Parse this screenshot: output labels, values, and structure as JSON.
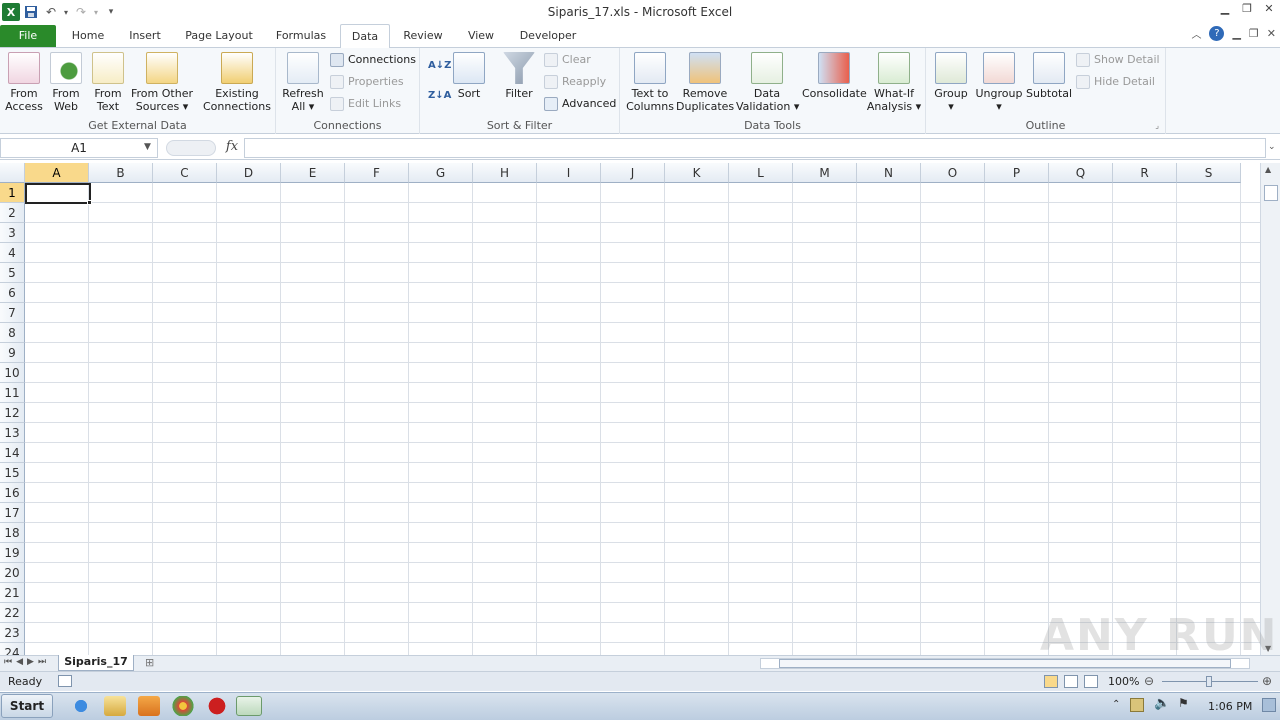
{
  "window": {
    "title": "Siparis_17.xls - Microsoft Excel"
  },
  "tabs": [
    {
      "label": "File"
    },
    {
      "label": "Home"
    },
    {
      "label": "Insert"
    },
    {
      "label": "Page Layout"
    },
    {
      "label": "Formulas"
    },
    {
      "label": "Data"
    },
    {
      "label": "Review"
    },
    {
      "label": "View"
    },
    {
      "label": "Developer"
    }
  ],
  "ribbon": {
    "get_external": {
      "label": "Get External Data",
      "from_access": "From\nAccess",
      "from_web": "From\nWeb",
      "from_text": "From\nText",
      "from_other": "From Other\nSources ▾",
      "existing": "Existing\nConnections"
    },
    "connections": {
      "label": "Connections",
      "refresh": "Refresh\nAll ▾",
      "connections": "Connections",
      "properties": "Properties",
      "edit_links": "Edit Links"
    },
    "sort_filter": {
      "label": "Sort & Filter",
      "sort": "Sort",
      "filter": "Filter",
      "clear": "Clear",
      "reapply": "Reapply",
      "advanced": "Advanced"
    },
    "data_tools": {
      "label": "Data Tools",
      "text_to_columns": "Text to\nColumns",
      "remove_duplicates": "Remove\nDuplicates",
      "data_validation": "Data\nValidation ▾",
      "consolidate": "Consolidate",
      "what_if": "What-If\nAnalysis ▾"
    },
    "outline": {
      "label": "Outline",
      "group": "Group\n▾",
      "ungroup": "Ungroup\n▾",
      "subtotal": "Subtotal",
      "show_detail": "Show Detail",
      "hide_detail": "Hide Detail"
    }
  },
  "namebox": "A1",
  "columns": [
    "A",
    "B",
    "C",
    "D",
    "E",
    "F",
    "G",
    "H",
    "I",
    "J",
    "K",
    "L",
    "M",
    "N",
    "O",
    "P",
    "Q",
    "R",
    "S"
  ],
  "rows": [
    "1",
    "2",
    "3",
    "4",
    "5",
    "6",
    "7",
    "8",
    "9",
    "10",
    "11",
    "12",
    "13",
    "14",
    "15",
    "16",
    "17",
    "18",
    "19",
    "20",
    "21",
    "22",
    "23",
    "24"
  ],
  "sheet_tab": "Siparis_17",
  "status": {
    "ready": "Ready",
    "zoom": "100%"
  },
  "taskbar": {
    "start": "Start",
    "time": "1:06 PM"
  },
  "watermark": "ANY RUN"
}
